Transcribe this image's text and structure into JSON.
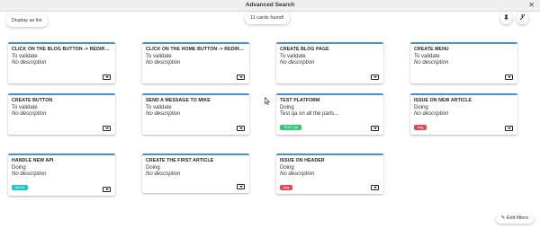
{
  "window": {
    "title": "Advanced Search",
    "close_icon": "close-icon"
  },
  "toolbar": {
    "display_as_list": "Display as list",
    "cards_found": "11 cards found!",
    "pin_icon": "pin-icon",
    "wrench_icon": "wrench-icon",
    "edit_filters": "Edit filters",
    "pencil_icon": "pencil-icon"
  },
  "tag_colors": {
    "TEST QA": "#2ecc71",
    "bug": "#e04b5a",
    "BACK": "#1bc9c0"
  },
  "cards": [
    {
      "title": "CLICK ON THE BLOG BUTTON -> REDIRECT TO ...",
      "status": "To validate",
      "description": "No description",
      "tag": ""
    },
    {
      "title": "CLICK ON THE HOME BUTTON -> REDIRECT T...",
      "status": "To validate",
      "description": "No description",
      "tag": ""
    },
    {
      "title": "CREATE BLOG PAGE",
      "status": "To validate",
      "description": "No description",
      "tag": ""
    },
    {
      "title": "CREATE MENU",
      "status": "To validate",
      "description": "No description",
      "tag": ""
    },
    {
      "title": "CREATE BUTTON",
      "status": "To validate",
      "description": "No description",
      "tag": ""
    },
    {
      "title": "SEND A MESSAGE TO MIKE",
      "status": "To validate",
      "description": "No description",
      "tag": ""
    },
    {
      "title": "TEST PLATFORM",
      "status": "Doing",
      "description": "Test qa on all the parts...",
      "tag": "TEST QA"
    },
    {
      "title": "ISSUE ON NEW ARTICLE",
      "status": "Doing",
      "description": "No description",
      "tag": "bug"
    },
    {
      "title": "HANDLE NEW API",
      "status": "Doing",
      "description": "No description",
      "tag": "BACK"
    },
    {
      "title": "CREATE THE FIRST ARTICLE",
      "status": "Doing",
      "description": "No description",
      "tag": ""
    },
    {
      "title": "ISSUE ON HEADER",
      "status": "Doing",
      "description": "No description",
      "tag": "bug"
    }
  ]
}
